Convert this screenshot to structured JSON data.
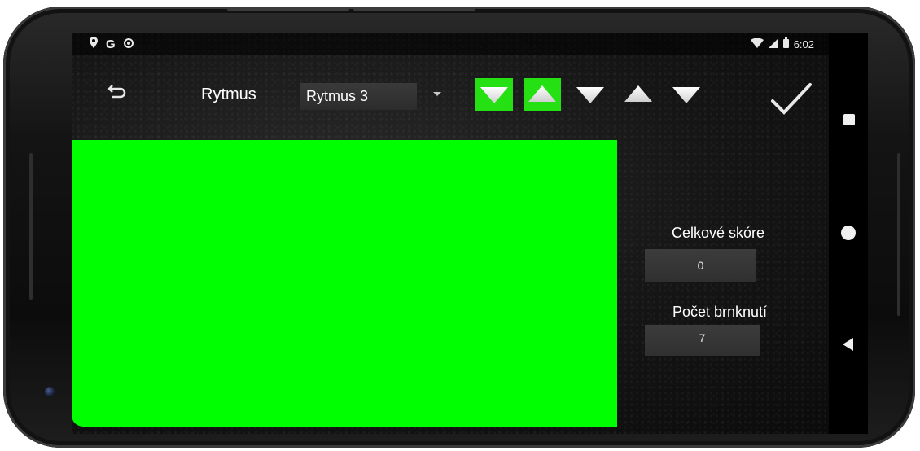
{
  "status_bar": {
    "icons_left": [
      "location-pin-icon",
      "google-g-icon",
      "circle-record-icon"
    ],
    "g_text": "G",
    "icons_right": [
      "wifi-icon",
      "signal-icon",
      "battery-icon"
    ],
    "time": "6:02"
  },
  "toolbar": {
    "back_icon": "return-arrow-icon",
    "title": "Rytmus",
    "dropdown": {
      "selected": "Rytmus 3",
      "arrow_icon": "dropdown-arrow-icon"
    },
    "pattern_buttons": [
      {
        "direction": "down",
        "icon": "triangle-down-icon",
        "active": true
      },
      {
        "direction": "up",
        "icon": "triangle-up-icon",
        "active": true
      },
      {
        "direction": "down",
        "icon": "triangle-down-icon",
        "active": false
      },
      {
        "direction": "up",
        "icon": "triangle-up-icon",
        "active": false
      },
      {
        "direction": "down",
        "icon": "triangle-down-icon",
        "active": false
      }
    ],
    "confirm_icon": "checkmark-icon",
    "active_color": "#25e012"
  },
  "main": {
    "panel_color": "#00ff00"
  },
  "stats": {
    "total_score_label": "Celkové skóre",
    "total_score_value": "0",
    "strum_count_label": "Počet brnknutí",
    "strum_count_value": "7"
  },
  "nav_bar": {
    "buttons": [
      "recents-square-icon",
      "home-circle-icon",
      "back-triangle-icon"
    ]
  }
}
